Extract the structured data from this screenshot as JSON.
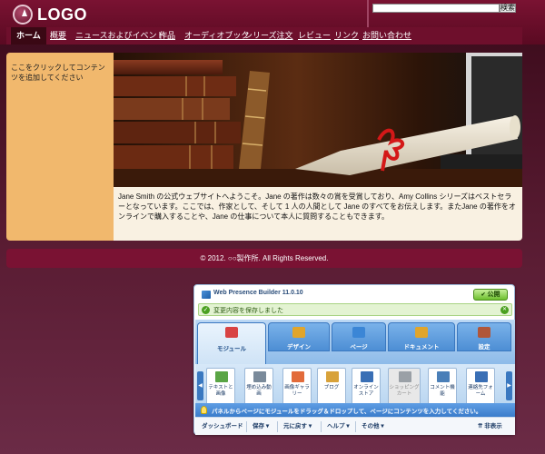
{
  "header": {
    "logo_text": "LOGO",
    "search_placeholder": "",
    "search_button": "検索"
  },
  "nav": {
    "items": [
      "ホーム",
      "概要",
      "ニュースおよびイベント",
      "作品",
      "オーディオブック",
      "シリーズ注文",
      "レビュー",
      "リンク",
      "お問い合わせ"
    ]
  },
  "sidebar": {
    "text": "ここをクリックしてコンテンツを追加してください"
  },
  "content": {
    "text": "Jane Smith の公式ウェブサイトへようこそ。Jane の著作は数々の賞を受賞しており、Amy Collins シリーズはベストセラーとなっています。ここでは、作家として、そして 1 人の人間として Jane のすべてをお伝えします。またJane の著作をオンラインで購入することや、Jane の仕事について本人に質問することもできます。"
  },
  "footer": {
    "text": "© 2012. ○○製作所. All Rights Reserved."
  },
  "builder": {
    "title": "Web Presence Builder 11.0.10",
    "publish_label": "公開",
    "status_text": "変更内容を保存しました",
    "tabs": [
      {
        "label": "モジュール",
        "icon": "modules-icon",
        "color": "#d84343"
      },
      {
        "label": "デザイン",
        "icon": "design-icon",
        "color": "#e0a52c"
      },
      {
        "label": "ページ",
        "icon": "pages-icon",
        "color": "#3b86d6"
      },
      {
        "label": "ドキュメント",
        "icon": "documents-icon",
        "color": "#e0a52c"
      },
      {
        "label": "設定",
        "icon": "settings-icon",
        "color": "#b0563a"
      }
    ],
    "modules": [
      {
        "label": "テキストと画像",
        "icon": "text-image-icon",
        "color": "#5aa545"
      },
      {
        "label": "埋め込み動画",
        "icon": "video-icon",
        "color": "#7a8a9a"
      },
      {
        "label": "画像ギャラリー",
        "icon": "gallery-icon",
        "color": "#e26b3a"
      },
      {
        "label": "ブログ",
        "icon": "blog-icon",
        "color": "#d8a23a"
      },
      {
        "label": "オンラインストア",
        "icon": "store-icon",
        "color": "#3a6fb5"
      },
      {
        "label": "ショッピングカート",
        "icon": "cart-icon",
        "color": "#9aa0a6"
      },
      {
        "label": "コメント機能",
        "icon": "comments-icon",
        "color": "#4a7fb8"
      },
      {
        "label": "連絡先フォーム",
        "icon": "contact-form-icon",
        "color": "#3a6fb5"
      }
    ],
    "hint_text": "パネルからページにモジュールをドラッグ＆ドロップして、ページにコンテンツを入力してください。",
    "toolbar": {
      "dashboard": "ダッシュボード",
      "save": "保存",
      "undo": "元に戻す",
      "help": "ヘルプ",
      "other": "その他",
      "hide": "非表示"
    }
  }
}
